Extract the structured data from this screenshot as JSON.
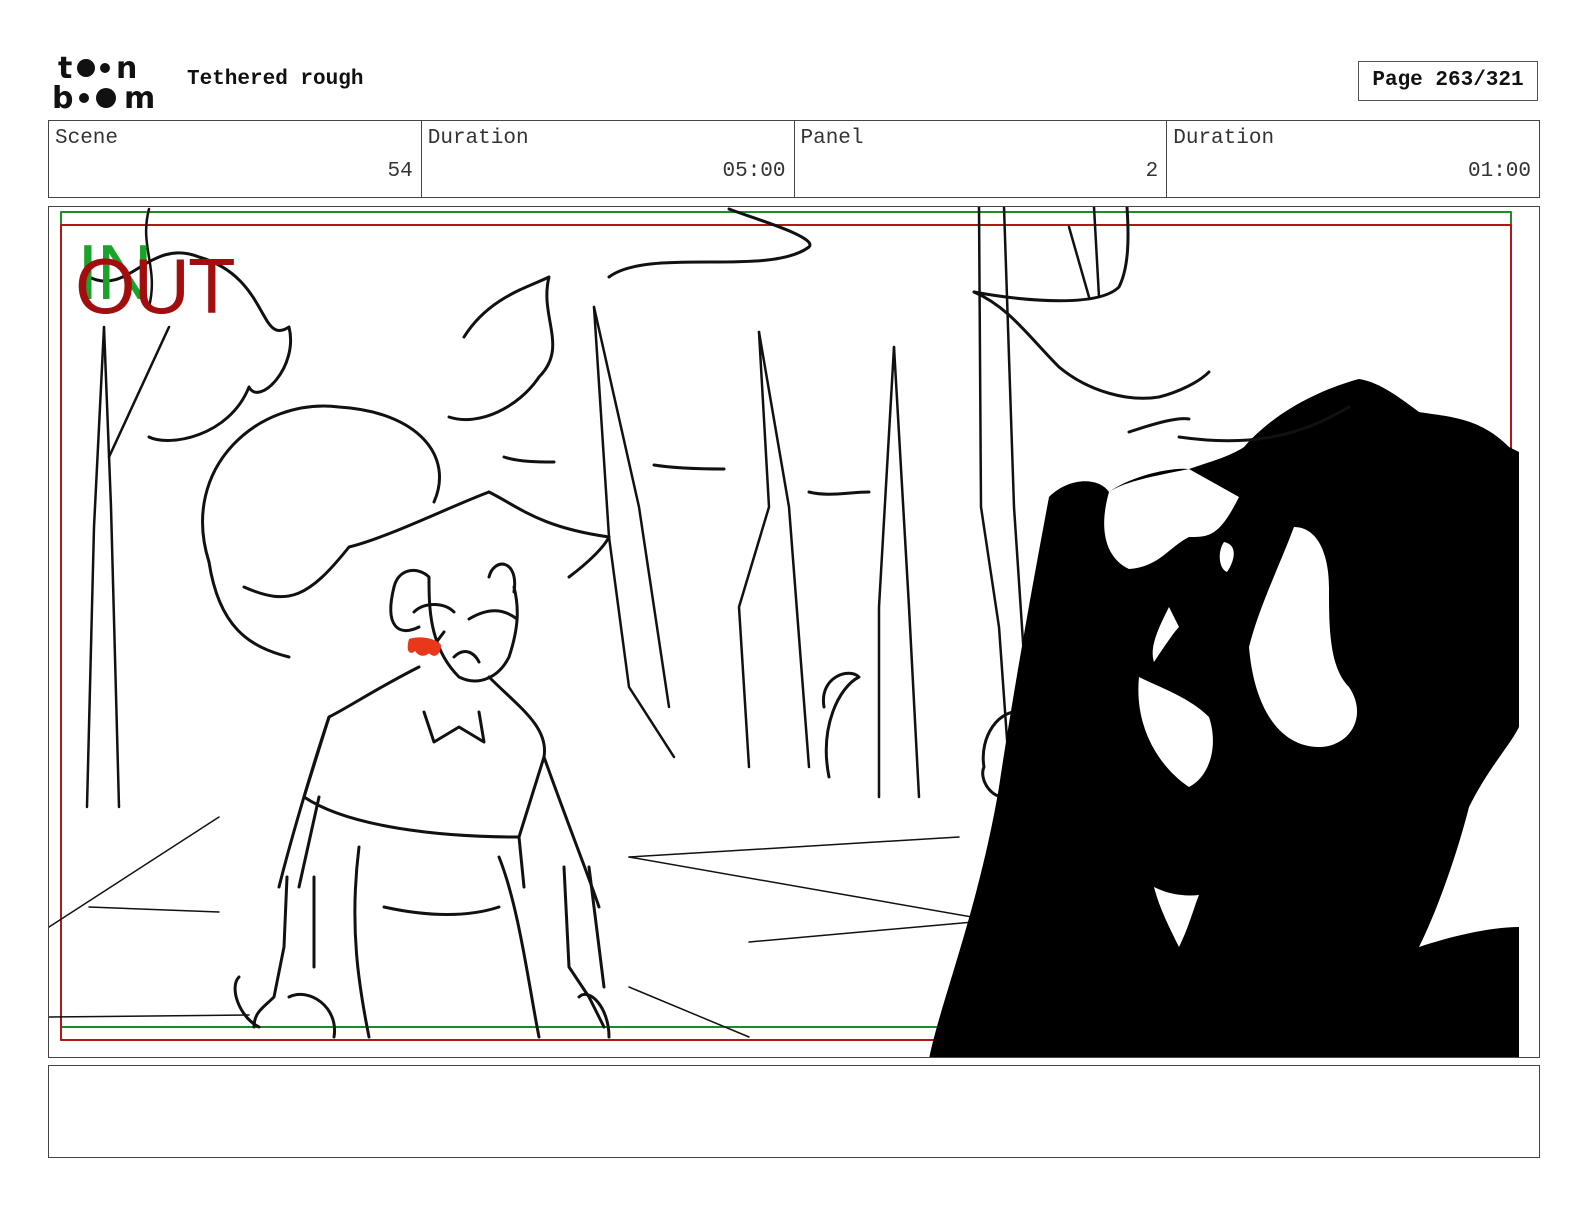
{
  "header": {
    "logo_text": "toon boom",
    "title": "Tethered rough",
    "page_label": "Page 263/321"
  },
  "info": {
    "scene_label": "Scene",
    "scene_value": "54",
    "scene_duration_label": "Duration",
    "scene_duration_value": "05:00",
    "panel_label": "Panel",
    "panel_value": "2",
    "panel_duration_label": "Duration",
    "panel_duration_value": "01:00"
  },
  "panel": {
    "in_mark": "IN",
    "out_mark": "OUT",
    "in_color": "#1aa32a",
    "out_color": "#a40d0d",
    "blood_color": "#e8371a"
  },
  "notes": {
    "text": ""
  }
}
